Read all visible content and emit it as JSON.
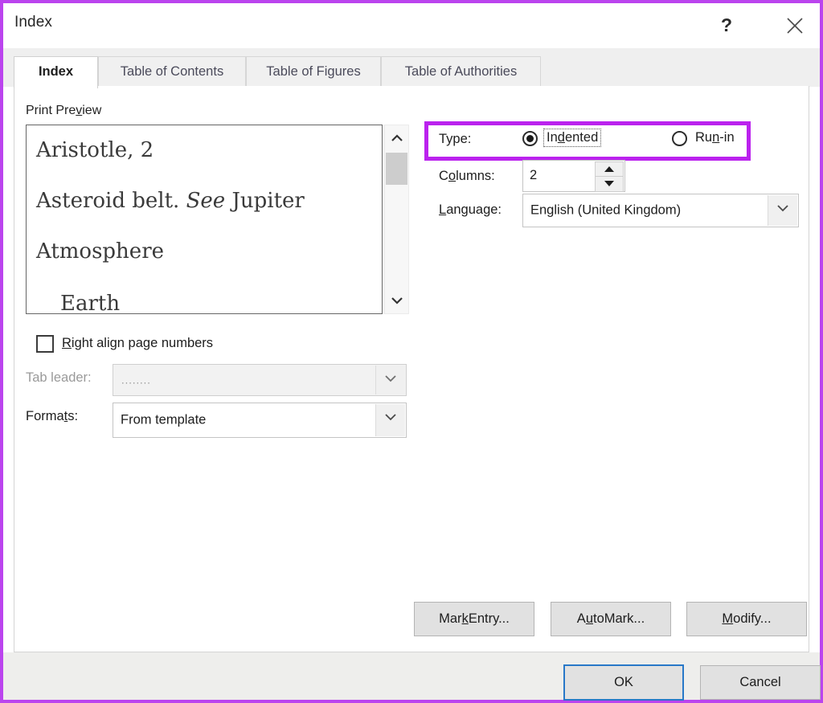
{
  "window": {
    "title": "Index",
    "help_icon": "question-mark-icon",
    "close_icon": "close-icon",
    "border_color": "#bb44ee"
  },
  "tabs": [
    {
      "label": "Index",
      "active": true
    },
    {
      "label": "Table of Contents",
      "active": false
    },
    {
      "label": "Table of Figures",
      "active": false
    },
    {
      "label": "Table of Authorities",
      "active": false
    }
  ],
  "preview": {
    "label": "Print Preview",
    "label_mnemonic": "v",
    "lines": [
      {
        "text": "Aristotle, 2",
        "indent": false,
        "italic_part": ""
      },
      {
        "text": "Asteroid belt. ",
        "italic_part": "See",
        "tail": " Jupiter",
        "indent": false
      },
      {
        "text": "Atmosphere",
        "indent": false,
        "italic_part": ""
      },
      {
        "text": "Earth",
        "indent": true,
        "italic_part": ""
      }
    ],
    "scrollbar": {
      "up_icon": "chevron-up-icon",
      "down_icon": "chevron-down-icon",
      "thumb_position": "near-top"
    }
  },
  "options": {
    "right_align": {
      "label": "Right align page numbers",
      "mnemonic": "R",
      "checked": false
    },
    "tab_leader": {
      "label": "Tab leader:",
      "value": "........",
      "disabled": true,
      "arrow_icon": "chevron-down-icon"
    },
    "formats": {
      "label": "Formats:",
      "mnemonic": "t",
      "value": "From template",
      "arrow_icon": "chevron-down-icon"
    }
  },
  "type_group": {
    "label": "Type:",
    "highlight_color": "#bb22ee",
    "options": [
      {
        "label_pre": "In",
        "mnemonic": "d",
        "label_post": "ented",
        "full": "Indented",
        "selected": true,
        "focused": true
      },
      {
        "label_pre": "Ru",
        "mnemonic": "n",
        "label_post": "-in",
        "full": "Run-in",
        "selected": false,
        "focused": false
      }
    ]
  },
  "columns": {
    "label": "Columns:",
    "mnemonic": "o",
    "value": "2",
    "up_icon": "triangle-up-icon",
    "down_icon": "triangle-down-icon"
  },
  "language": {
    "label": "Language:",
    "mnemonic": "L",
    "value": "English (United Kingdom)",
    "arrow_icon": "chevron-down-icon"
  },
  "actions": {
    "mark_entry": {
      "pre": "Mar",
      "mnemonic": "k",
      "post": " Entry...",
      "full": "Mark Entry..."
    },
    "automark": {
      "pre": "A",
      "mnemonic": "u",
      "post": "toMark...",
      "full": "AutoMark..."
    },
    "modify": {
      "pre": "",
      "mnemonic": "M",
      "post": "odify...",
      "full": "Modify..."
    }
  },
  "footer": {
    "ok": "OK",
    "cancel": "Cancel",
    "ok_focused": true
  }
}
